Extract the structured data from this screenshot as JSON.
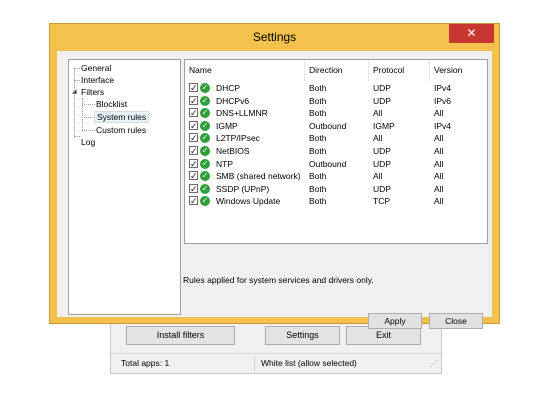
{
  "dialog": {
    "title": "Settings",
    "close_glyph": "✕"
  },
  "tree": {
    "items": [
      {
        "label": "General"
      },
      {
        "label": "Interface"
      },
      {
        "label": "Filters"
      },
      {
        "label": "Blocklist"
      },
      {
        "label": "System rules"
      },
      {
        "label": "Custom rules"
      },
      {
        "label": "Log"
      }
    ]
  },
  "list": {
    "columns": [
      "Name",
      "Direction",
      "Protocol",
      "Version"
    ],
    "rows": [
      {
        "name": "DHCP",
        "direction": "Both",
        "protocol": "UDP",
        "version": "IPv4"
      },
      {
        "name": "DHCPv6",
        "direction": "Both",
        "protocol": "UDP",
        "version": "IPv6"
      },
      {
        "name": "DNS+LLMNR",
        "direction": "Both",
        "protocol": "All",
        "version": "All"
      },
      {
        "name": "IGMP",
        "direction": "Outbound",
        "protocol": "IGMP",
        "version": "IPv4"
      },
      {
        "name": "L2TP/IPsec",
        "direction": "Both",
        "protocol": "All",
        "version": "All"
      },
      {
        "name": "NetBIOS",
        "direction": "Both",
        "protocol": "UDP",
        "version": "All"
      },
      {
        "name": "NTP",
        "direction": "Outbound",
        "protocol": "UDP",
        "version": "All"
      },
      {
        "name": "SMB (shared network)",
        "direction": "Both",
        "protocol": "All",
        "version": "All"
      },
      {
        "name": "SSDP (UPnP)",
        "direction": "Both",
        "protocol": "UDP",
        "version": "All"
      },
      {
        "name": "Windows Update",
        "direction": "Both",
        "protocol": "TCP",
        "version": "All"
      }
    ],
    "check_glyph": "✓"
  },
  "note": "Rules applied for system services and drivers only.",
  "buttons": {
    "apply": "Apply",
    "close": "Close"
  },
  "mainwin": {
    "install_label": "Install filters",
    "settings_label": "Settings",
    "exit_label": "Exit",
    "status_apps": "Total apps: 1",
    "status_mode": "White list (allow selected)"
  },
  "colors": {
    "titlebar": "#f4c14f",
    "close": "#c7372f",
    "status_ok": "#2e9e3a"
  }
}
